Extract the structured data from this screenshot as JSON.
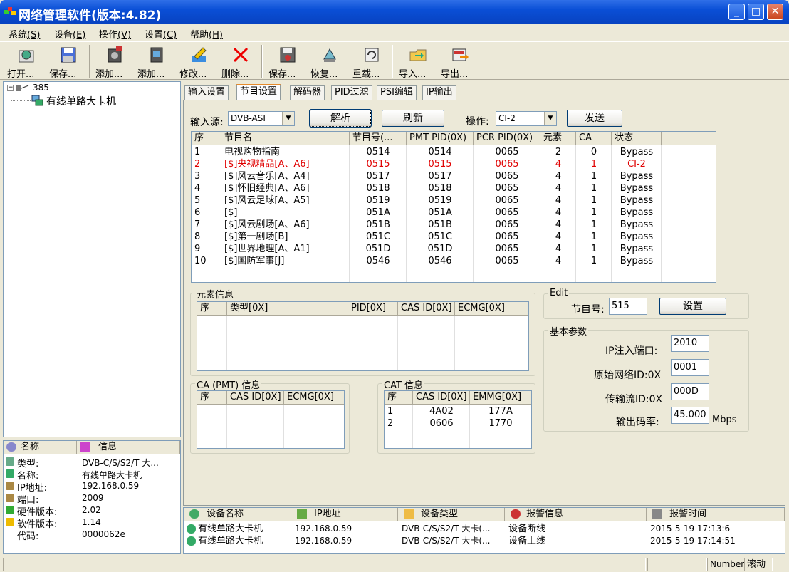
{
  "window": {
    "title": "网络管理软件(版本:4.82)"
  },
  "menu": [
    {
      "label": "系统",
      "key": "(S)"
    },
    {
      "label": "设备",
      "key": "(E)"
    },
    {
      "label": "操作",
      "key": "(V)"
    },
    {
      "label": "设置",
      "key": "(C)"
    },
    {
      "label": "帮助",
      "key": "(H)"
    }
  ],
  "toolbar": [
    "打开...",
    "保存...",
    "添加...",
    "添加...",
    "修改...",
    "删除...",
    "保存...",
    "恢复...",
    "重载...",
    "导入...",
    "导出..."
  ],
  "tree": {
    "root": "385",
    "child": "有线单路大卡机"
  },
  "info": {
    "headers": [
      "名称",
      "信息"
    ],
    "rows": [
      {
        "k": "类型:",
        "v": "DVB-C/S/S2/T 大..."
      },
      {
        "k": "名称:",
        "v": "有线单路大卡机"
      },
      {
        "k": "IP地址:",
        "v": "192.168.0.59"
      },
      {
        "k": "端口:",
        "v": "2009"
      },
      {
        "k": "硬件版本:",
        "v": "2.02"
      },
      {
        "k": "软件版本:",
        "v": "1.14"
      },
      {
        "k": "代码:",
        "v": "0000062e"
      }
    ]
  },
  "tabs": [
    "输入设置",
    "节目设置",
    "解码器",
    "PID过滤",
    "PSI编辑",
    "IP输出"
  ],
  "controls": {
    "input_label": "输入源:",
    "input_value": "DVB-ASI",
    "parse": "解析",
    "refresh": "刷新",
    "op_label": "操作:",
    "op_value": "CI-2",
    "send": "发送"
  },
  "programs": {
    "headers": [
      "序",
      "节目名",
      "节目号(...",
      "PMT PID(0X)",
      "PCR PID(0X)",
      "元素",
      "CA",
      "状态"
    ],
    "rows": [
      [
        "1",
        "电视购物指南",
        "0514",
        "0514",
        "0065",
        "2",
        "0",
        "Bypass"
      ],
      [
        "2",
        "[$]央视精品[A、A6]",
        "0515",
        "0515",
        "0065",
        "4",
        "1",
        "CI-2"
      ],
      [
        "3",
        "[$]风云音乐[A、A4]",
        "0517",
        "0517",
        "0065",
        "4",
        "1",
        "Bypass"
      ],
      [
        "4",
        "[$]怀旧经典[A、A6]",
        "0518",
        "0518",
        "0065",
        "4",
        "1",
        "Bypass"
      ],
      [
        "5",
        "[$]风云足球[A、A5]",
        "0519",
        "0519",
        "0065",
        "4",
        "1",
        "Bypass"
      ],
      [
        "6",
        "[$]",
        "051A",
        "051A",
        "0065",
        "4",
        "1",
        "Bypass"
      ],
      [
        "7",
        "[$]风云剧场[A、A6]",
        "051B",
        "051B",
        "0065",
        "4",
        "1",
        "Bypass"
      ],
      [
        "8",
        "[$]第一剧场[B]",
        "051C",
        "051C",
        "0065",
        "4",
        "1",
        "Bypass"
      ],
      [
        "9",
        "[$]世界地理[A、A1]",
        "051D",
        "051D",
        "0065",
        "4",
        "1",
        "Bypass"
      ],
      [
        "10",
        "[$]国防军事[J]",
        "0546",
        "0546",
        "0065",
        "4",
        "1",
        "Bypass"
      ]
    ]
  },
  "element": {
    "title": "元素信息",
    "headers": [
      "序",
      "类型[0X]",
      "PID[0X]",
      "CAS ID[0X]",
      "ECMG[0X]"
    ]
  },
  "ca_pmt": {
    "title": "CA (PMT) 信息",
    "headers": [
      "序",
      "CAS ID[0X]",
      "ECMG[0X]"
    ]
  },
  "cat": {
    "title": "CAT 信息",
    "headers": [
      "序",
      "CAS ID[0X]",
      "EMMG[0X]"
    ],
    "rows": [
      [
        "1",
        "4A02",
        "177A"
      ],
      [
        "2",
        "0606",
        "1770"
      ]
    ]
  },
  "edit": {
    "title": "Edit",
    "prog_label": "节目号:",
    "prog_value": "515",
    "set": "设置"
  },
  "basic": {
    "title": "基本参数",
    "fields": [
      {
        "label": "IP注入端口:",
        "value": "2010"
      },
      {
        "label": "原始网络ID:0X",
        "value": "0001"
      },
      {
        "label": "传输流ID:0X",
        "value": "000D"
      },
      {
        "label": "输出码率:",
        "value": "45.000"
      }
    ],
    "unit": "Mbps"
  },
  "alarms": {
    "headers": [
      "设备名称",
      "IP地址",
      "设备类型",
      "报警信息",
      "报警时间"
    ],
    "rows": [
      [
        "有线单路大卡机",
        "192.168.0.59",
        "DVB-C/S/S2/T 大卡(...",
        "设备断线",
        "2015-5-19 17:13:6"
      ],
      [
        "有线单路大卡机",
        "192.168.0.59",
        "DVB-C/S/S2/T 大卡(...",
        "设备上线",
        "2015-5-19 17:14:51"
      ]
    ]
  },
  "status": {
    "number": "Number",
    "scroll": "滚动"
  }
}
